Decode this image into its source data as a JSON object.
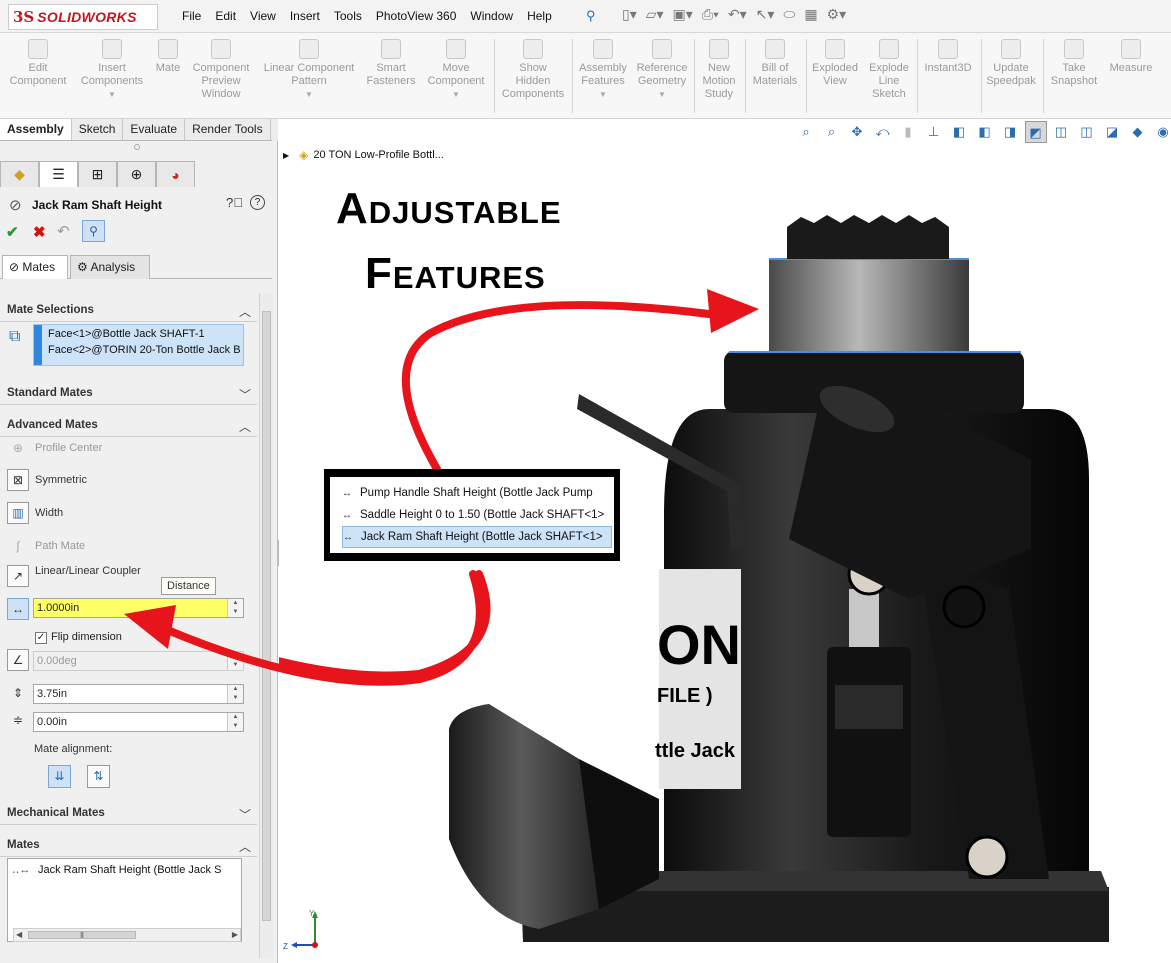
{
  "app": {
    "logo_ds": "3S",
    "logo_name": "SOLIDWORKS",
    "menu": [
      "File",
      "Edit",
      "View",
      "Insert",
      "Tools",
      "PhotoView 360",
      "Window",
      "Help"
    ]
  },
  "commands": [
    {
      "label": "Edit\nComponent",
      "dropdown": false
    },
    {
      "label": "Insert\nComponents",
      "dropdown": true
    },
    {
      "label": "Mate",
      "dropdown": false
    },
    {
      "label": "Component\nPreview\nWindow",
      "dropdown": false
    },
    {
      "label": "Linear Component\nPattern",
      "dropdown": true
    },
    {
      "label": "Smart\nFasteners",
      "dropdown": false
    },
    {
      "label": "Move\nComponent",
      "dropdown": true
    },
    {
      "label": "Show\nHidden\nComponents",
      "dropdown": false
    },
    {
      "label": "Assembly\nFeatures",
      "dropdown": true
    },
    {
      "label": "Reference\nGeometry",
      "dropdown": true
    },
    {
      "label": "New\nMotion\nStudy",
      "dropdown": false
    },
    {
      "label": "Bill of\nMaterials",
      "dropdown": false
    },
    {
      "label": "Exploded\nView",
      "dropdown": false
    },
    {
      "label": "Explode\nLine\nSketch",
      "dropdown": false
    },
    {
      "label": "Instant3D",
      "dropdown": false
    },
    {
      "label": "Update\nSpeedpak",
      "dropdown": false
    },
    {
      "label": "Take\nSnapshot",
      "dropdown": false
    },
    {
      "label": "Measure",
      "dropdown": false
    }
  ],
  "tabs": [
    "Assembly",
    "Sketch",
    "Evaluate",
    "Render Tools"
  ],
  "property_manager": {
    "title": "Jack Ram Shaft Height",
    "subtabs": [
      "Mates",
      "Analysis"
    ],
    "mate_selections": {
      "heading": "Mate Selections",
      "items": [
        "Face<1>@Bottle Jack SHAFT-1",
        "Face<2>@TORIN 20-Ton Bottle Jack B"
      ]
    },
    "standard_mates_heading": "Standard Mates",
    "advanced_mates_heading": "Advanced Mates",
    "advanced_options": [
      "Profile Center",
      "Symmetric",
      "Width",
      "Path Mate",
      "Linear/Linear Coupler"
    ],
    "tooltip": "Distance",
    "distance_value": "1.0000in",
    "flip_label": "Flip dimension",
    "angle_value": "0.00deg",
    "max_value": "3.75in",
    "min_value": "0.00in",
    "alignment_label": "Mate alignment:",
    "mechanical_mates_heading": "Mechanical Mates",
    "mates_heading": "Mates",
    "mates_item": "Jack Ram Shaft Height (Bottle Jack S"
  },
  "viewport": {
    "tree_root": "20 TON Low-Profile Bottl...",
    "headline_line1": "Adjustable",
    "headline_line2": "Features",
    "callout_items": [
      "Pump Handle Shaft Height (Bottle Jack Pump",
      "Saddle Height 0 to 1.50 (Bottle Jack SHAFT<1>",
      "Jack Ram Shaft Height (Bottle Jack SHAFT<1>"
    ],
    "label_plate_text": "ON",
    "label_plate_sub": "FILE )",
    "label_plate_sub2": "ttle Jack",
    "axis_y": "Y",
    "axis_z": "Z"
  },
  "colors": {
    "brand_red": "#c4161c",
    "arrow_red": "#e8141b",
    "selection_blue": "#cde3f8",
    "highlight_yellow": "#ffff66"
  }
}
